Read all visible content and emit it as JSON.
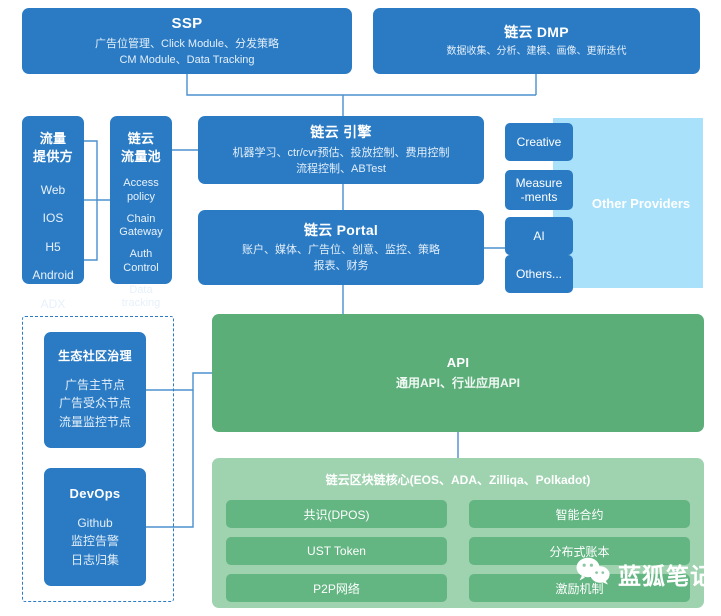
{
  "colors": {
    "blue": "#2b7bc4",
    "light_blue": "#a9e1fa",
    "green": "#5bae78",
    "light_green": "#9fd3b0",
    "green_cell": "#63b582",
    "wire": "#4a90cf",
    "text_on_blue": "#ffffff"
  },
  "top_row": {
    "ssp": {
      "title": "SSP",
      "line1": "广告位管理、Click Module、分发策略",
      "line2": "CM Module、Data Tracking"
    },
    "dmp": {
      "title": "链云 DMP",
      "line1": "数据收集、分析、建模、画像、更新迭代"
    }
  },
  "left_column": {
    "traffic_provider": {
      "title_line1": "流量",
      "title_line2": "提供方",
      "items": [
        "Web",
        "IOS",
        "H5",
        "Android",
        "ADX"
      ]
    },
    "traffic_pool": {
      "title_line1": "链云",
      "title_line2": "流量池",
      "items": [
        "Access\npolicy",
        "Chain\nGateway",
        "Auth\nControl",
        "Data\ntracking"
      ]
    }
  },
  "center": {
    "engine": {
      "title": "链云 引擎",
      "line1": "机器学习、ctr/cvr预估、投放控制、费用控制",
      "line2": "流程控制、ABTest"
    },
    "portal": {
      "title": "链云 Portal",
      "line1": "账户、媒体、广告位、创意、监控、策略",
      "line2": "报表、财务"
    }
  },
  "other_providers": {
    "panel_label": "Other Providers",
    "chips": [
      "Creative",
      "Measure\n-ments",
      "AI",
      "Others..."
    ]
  },
  "governance": {
    "eco": {
      "title": "生态社区治理",
      "line1": "广告主节点",
      "line2": "广告受众节点",
      "line3": "流量监控节点"
    },
    "devops": {
      "title": "DevOps",
      "line1": "Github",
      "line2": "监控告警",
      "line3": "日志归集"
    }
  },
  "api": {
    "title": "API",
    "subtitle": "通用API、行业应用API"
  },
  "chain_core": {
    "title": "链云区块链核心(EOS、ADA、Zilliqa、Polkadot)",
    "cells": [
      "共识(DPOS)",
      "智能合约",
      "UST Token",
      "分布式账本",
      "P2P网络",
      "激励机制"
    ]
  },
  "watermark": {
    "icon": "wechat-icon",
    "text": "蓝狐笔记"
  }
}
